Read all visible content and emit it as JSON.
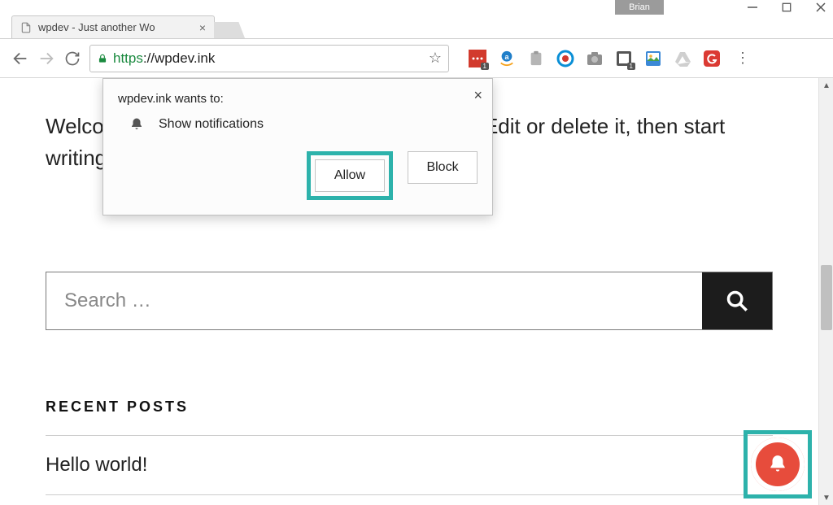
{
  "window": {
    "profile": "Brian"
  },
  "tab": {
    "title": "wpdev - Just another Wo"
  },
  "url": {
    "scheme": "https",
    "rest": "://wpdev.ink"
  },
  "extensions": {
    "lastpass_badge": "1",
    "skitch_badge": "1"
  },
  "permission": {
    "origin": "wpdev.ink wants to:",
    "request": "Show notifications",
    "allow": "Allow",
    "block": "Block"
  },
  "page": {
    "intro": "Welcome to WordPress. This is your first post. Edit or delete it, then start writing!",
    "search_placeholder": "Search …",
    "recent_heading": "RECENT POSTS",
    "recent_items": [
      "Hello world!"
    ]
  }
}
